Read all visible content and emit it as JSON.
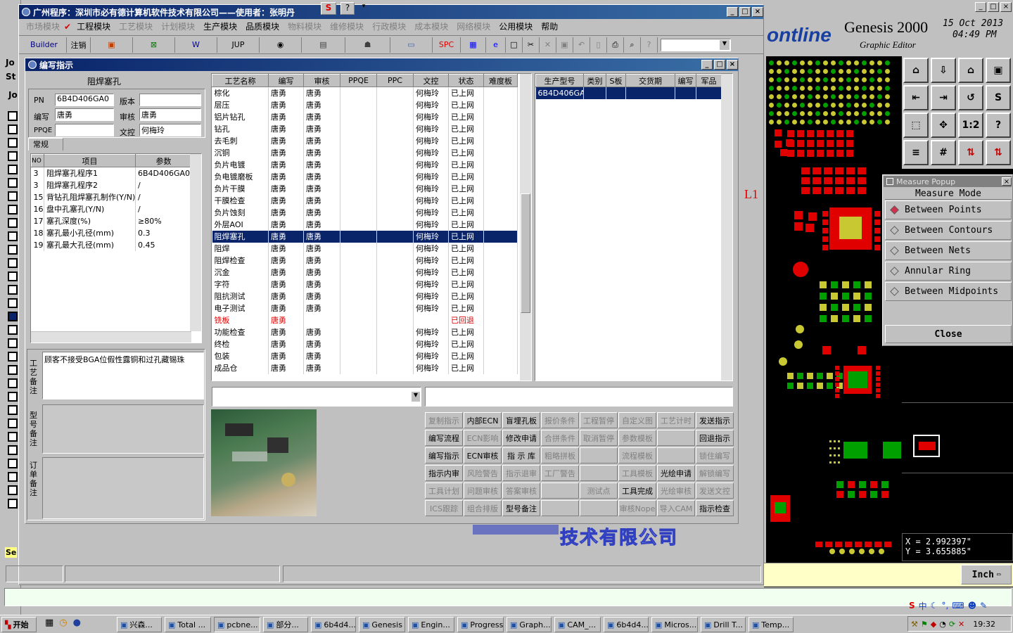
{
  "main_window": {
    "title": "广州程序：深圳市必有德计算机软件技术有限公司——使用者：张明丹"
  },
  "menu": [
    {
      "label": "市场模块",
      "enabled": false
    },
    {
      "label": "工程模块",
      "enabled": true
    },
    {
      "label": "工艺模块",
      "enabled": false
    },
    {
      "label": "计划模块",
      "enabled": false
    },
    {
      "label": "生产模块",
      "enabled": true
    },
    {
      "label": "品质模块",
      "enabled": true
    },
    {
      "label": "物料模块",
      "enabled": false
    },
    {
      "label": "维修模块",
      "enabled": false
    },
    {
      "label": "行政模块",
      "enabled": false
    },
    {
      "label": "成本模块",
      "enabled": false
    },
    {
      "label": "网络模块",
      "enabled": false
    },
    {
      "label": "公用模块",
      "enabled": true
    },
    {
      "label": "帮助",
      "enabled": true
    }
  ],
  "toolbar": {
    "builder": "Builder",
    "logout": "注销",
    "jup": "JUP",
    "spc": "SPC"
  },
  "dialog": {
    "title": "编写指示",
    "panel_title": "阻焊塞孔",
    "fields": {
      "pn_label": "PN",
      "pn_value": "6B4D406GA0",
      "version_label": "版本",
      "version_value": "",
      "writer_label": "编写",
      "writer_value": "唐勇",
      "reviewer_label": "审核",
      "reviewer_value": "唐勇",
      "ppqe_label": "PPQE",
      "ppqe_value": "",
      "doc_label": "文控",
      "doc_value": "何梅玲"
    },
    "tab_general": "常规",
    "param_headers": [
      "NO",
      "项目",
      "参数"
    ],
    "params": [
      [
        "3",
        "阻焊塞孔程序1",
        "6B4D406GA0.cv"
      ],
      [
        "3",
        "阻焊塞孔程序2",
        "/"
      ],
      [
        "15",
        "背钻孔阻焊塞孔制作(Y/N)",
        "/"
      ],
      [
        "16",
        "盘中孔塞孔(Y/N)",
        "/"
      ],
      [
        "17",
        "塞孔深度(%)",
        "≥80%"
      ],
      [
        "18",
        "塞孔最小孔径(mm)",
        "0.3"
      ],
      [
        "19",
        "塞孔最大孔径(mm)",
        "0.45"
      ]
    ],
    "remark_labels": [
      "工艺备注",
      "型号备注",
      "订单备注"
    ],
    "remark_text": "顾客不接受BGA位假性露铜和过孔藏锡珠",
    "process_headers": [
      "工艺名称",
      "编写",
      "审核",
      "PPQE",
      "PPC",
      "文控",
      "状态",
      "难度板"
    ],
    "processes": [
      [
        "棕化",
        "唐勇",
        "唐勇",
        "",
        "",
        "何梅玲",
        "已上网",
        ""
      ],
      [
        "层压",
        "唐勇",
        "唐勇",
        "",
        "",
        "何梅玲",
        "已上网",
        ""
      ],
      [
        "铝片钻孔",
        "唐勇",
        "唐勇",
        "",
        "",
        "何梅玲",
        "已上网",
        ""
      ],
      [
        "钻孔",
        "唐勇",
        "唐勇",
        "",
        "",
        "何梅玲",
        "已上网",
        ""
      ],
      [
        "去毛刺",
        "唐勇",
        "唐勇",
        "",
        "",
        "何梅玲",
        "已上网",
        ""
      ],
      [
        "沉铜",
        "唐勇",
        "唐勇",
        "",
        "",
        "何梅玲",
        "已上网",
        ""
      ],
      [
        "负片电镀",
        "唐勇",
        "唐勇",
        "",
        "",
        "何梅玲",
        "已上网",
        ""
      ],
      [
        "负电镀磨板",
        "唐勇",
        "唐勇",
        "",
        "",
        "何梅玲",
        "已上网",
        ""
      ],
      [
        "负片干膜",
        "唐勇",
        "唐勇",
        "",
        "",
        "何梅玲",
        "已上网",
        ""
      ],
      [
        "干膜检查",
        "唐勇",
        "唐勇",
        "",
        "",
        "何梅玲",
        "已上网",
        ""
      ],
      [
        "负片蚀刻",
        "唐勇",
        "唐勇",
        "",
        "",
        "何梅玲",
        "已上网",
        ""
      ],
      [
        "外层AOI",
        "唐勇",
        "唐勇",
        "",
        "",
        "何梅玲",
        "已上网",
        ""
      ],
      [
        "阻焊塞孔",
        "唐勇",
        "唐勇",
        "",
        "",
        "何梅玲",
        "已上网",
        ""
      ],
      [
        "阻焊",
        "唐勇",
        "唐勇",
        "",
        "",
        "何梅玲",
        "已上网",
        ""
      ],
      [
        "阻焊检查",
        "唐勇",
        "唐勇",
        "",
        "",
        "何梅玲",
        "已上网",
        ""
      ],
      [
        "沉金",
        "唐勇",
        "唐勇",
        "",
        "",
        "何梅玲",
        "已上网",
        ""
      ],
      [
        "字符",
        "唐勇",
        "唐勇",
        "",
        "",
        "何梅玲",
        "已上网",
        ""
      ],
      [
        "阻抗测试",
        "唐勇",
        "唐勇",
        "",
        "",
        "何梅玲",
        "已上网",
        ""
      ],
      [
        "电子测试",
        "唐勇",
        "唐勇",
        "",
        "",
        "何梅玲",
        "已上网",
        ""
      ],
      [
        "铣板",
        "唐勇",
        "",
        "",
        "",
        "",
        "已回退",
        ""
      ],
      [
        "功能检查",
        "唐勇",
        "唐勇",
        "",
        "",
        "何梅玲",
        "已上网",
        ""
      ],
      [
        "终检",
        "唐勇",
        "唐勇",
        "",
        "",
        "何梅玲",
        "已上网",
        ""
      ],
      [
        "包装",
        "唐勇",
        "唐勇",
        "",
        "",
        "何梅玲",
        "已上网",
        ""
      ],
      [
        "成品仓",
        "唐勇",
        "唐勇",
        "",
        "",
        "何梅玲",
        "已上网",
        ""
      ]
    ],
    "selected_process": 12,
    "rejected_process": 19,
    "model_headers": [
      "生产型号",
      "类别",
      "S板",
      "交货期",
      "编写",
      "军品"
    ],
    "models": [
      [
        "6B4D406GA0",
        "",
        "",
        "",
        "",
        ""
      ]
    ],
    "buttons": [
      [
        "复制指示",
        "内部ECN",
        "盲埋孔板",
        "报价条件",
        "工程暂停",
        "自定义图",
        "工艺计时",
        "发送指示"
      ],
      [
        "编写流程",
        "ECN影响",
        "修改申请",
        "合拼条件",
        "取消暂停",
        "参数模板",
        "",
        "回退指示"
      ],
      [
        "编写指示",
        "ECN审核",
        "指 示 库",
        "粗略拼板",
        "",
        "流程模板",
        "",
        "锁住编写"
      ],
      [
        "指示内审",
        "风险警告",
        "指示退审",
        "工厂警告",
        "",
        "工具模板",
        "光绘申请",
        "解锁编写"
      ],
      [
        "工具计划",
        "问题审核",
        "答案审核",
        "",
        "测试点",
        "工具完成",
        "光绘审核",
        "发送文控"
      ],
      [
        "ICS跟踪",
        "组合排版",
        "型号备注",
        "",
        "",
        "审核Nope",
        "导入CAM",
        "指示检查"
      ]
    ],
    "enabled_buttons": [
      "内部ECN",
      "盲埋孔板",
      "发送指示",
      "编写流程",
      "修改申请",
      "回退指示",
      "编写指示",
      "ECN审核",
      "指 示 库",
      "指示内审",
      "光绘申请",
      "工具完成",
      "型号备注",
      "指示检查"
    ]
  },
  "watermark": "技术有限公司",
  "genesis": {
    "logo": "ontline",
    "title": "Genesis 2000",
    "subtitle": "Graphic Editor",
    "date": "15 Oct 2013",
    "time": "04:49 PM",
    "layer_label": "L1",
    "coord_x": "X = 2.992397\"",
    "coord_y": "Y = 3.655885\"",
    "units": "Inch"
  },
  "measure_popup": {
    "title": "Measure Popup",
    "header": "Measure Mode",
    "modes": [
      "Between Points",
      "Between Contours",
      "Between Nets",
      "Annular Ring",
      "Between Midpoints"
    ],
    "selected": 0,
    "close": "Close"
  },
  "left_strip": [
    "Jo",
    "St",
    "Jo",
    "Se"
  ],
  "taskbar": {
    "start": "开始",
    "items": [
      "兴森...",
      "Total ...",
      "pcbne...",
      "部分...",
      "6b4d4...",
      "Genesis",
      "Engin...",
      "Progress",
      "Graph...",
      "CAM_...",
      "6b4d4...",
      "Micros...",
      "Drill T...",
      "Temp..."
    ],
    "clock": "19:32",
    "ime": "中"
  }
}
